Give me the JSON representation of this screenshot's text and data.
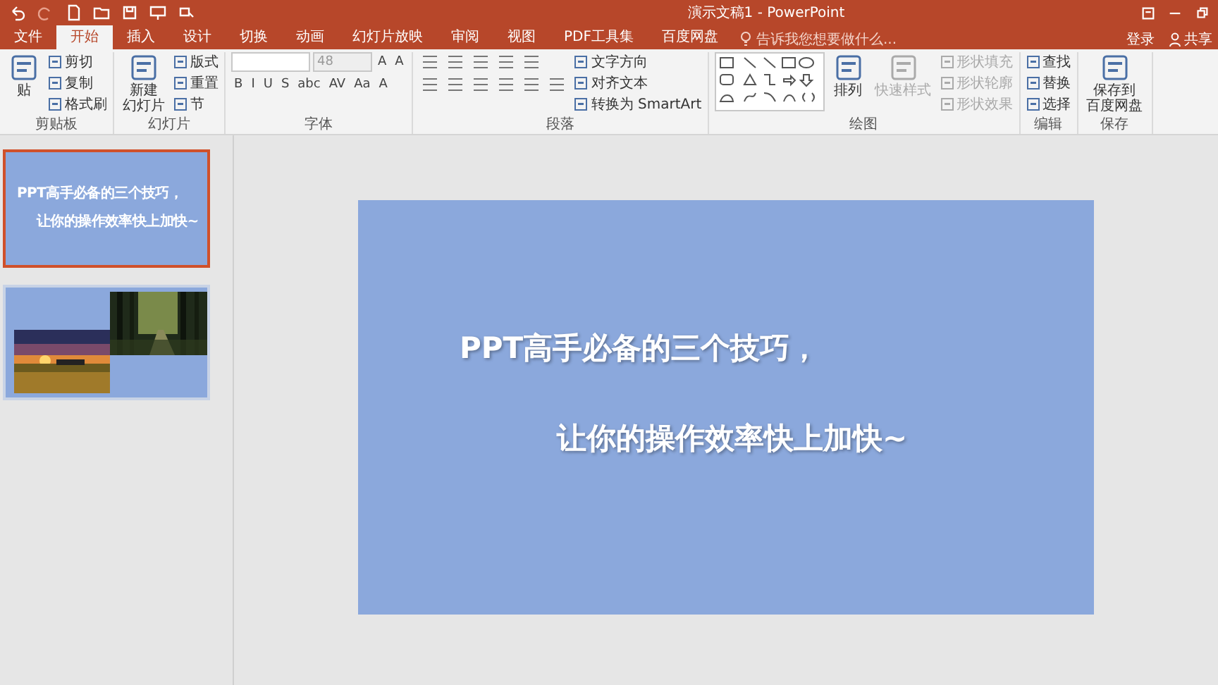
{
  "title_bar": {
    "title": "演示文稿1 - PowerPoint"
  },
  "tabs": [
    {
      "label": "文件",
      "selected": false
    },
    {
      "label": "开始",
      "selected": true
    },
    {
      "label": "插入",
      "selected": false
    },
    {
      "label": "设计",
      "selected": false
    },
    {
      "label": "切换",
      "selected": false
    },
    {
      "label": "动画",
      "selected": false
    },
    {
      "label": "幻灯片放映",
      "selected": false
    },
    {
      "label": "审阅",
      "selected": false
    },
    {
      "label": "视图",
      "selected": false
    },
    {
      "label": "PDF工具集",
      "selected": false
    },
    {
      "label": "百度网盘",
      "selected": false
    }
  ],
  "tell_me": {
    "placeholder": "告诉我您想要做什么..."
  },
  "account": {
    "sign_in": "登录",
    "share": "共享"
  },
  "ribbon": [
    {
      "label": "剪贴板",
      "columns": [
        [
          [
            {
              "kind": "large",
              "lines": [
                "贴"
              ],
              "disabled": false
            }
          ]
        ],
        [
          [
            {
              "kind": "small",
              "label": "剪切",
              "disabled": false
            }
          ],
          [
            {
              "kind": "small",
              "label": "复制",
              "disabled": false
            }
          ],
          [
            {
              "kind": "small",
              "label": "格式刷",
              "disabled": false
            }
          ]
        ]
      ]
    },
    {
      "label": "幻灯片",
      "columns": [
        [
          [
            {
              "kind": "large",
              "lines": [
                "新建",
                "幻灯片"
              ],
              "disabled": false
            }
          ]
        ],
        [
          [
            {
              "kind": "small",
              "label": "版式",
              "disabled": false
            }
          ],
          [
            {
              "kind": "small",
              "label": "重置",
              "disabled": false
            }
          ],
          [
            {
              "kind": "small",
              "label": "节",
              "disabled": false
            }
          ]
        ]
      ]
    },
    {
      "label": "字体",
      "columns": [
        [
          [
            {
              "kind": "field",
              "disabled": false
            },
            {
              "kind": "field",
              "label": "48",
              "disabled": true
            },
            {
              "kind": "glyph",
              "label": "A",
              "disabled": false
            },
            {
              "kind": "glyph",
              "label": "A",
              "disabled": false
            }
          ],
          [
            {
              "kind": "glyph",
              "label": "B",
              "disabled": false
            },
            {
              "kind": "glyph",
              "label": "I",
              "disabled": false
            },
            {
              "kind": "glyph",
              "label": "U",
              "disabled": false
            },
            {
              "kind": "glyph",
              "label": "S",
              "disabled": false
            },
            {
              "kind": "glyph",
              "label": "abc",
              "disabled": false
            },
            {
              "kind": "glyph",
              "label": "AV",
              "disabled": false
            },
            {
              "kind": "glyph",
              "label": "Aa",
              "disabled": false
            },
            {
              "kind": "glyph",
              "label": "A",
              "disabled": false
            }
          ]
        ]
      ]
    },
    {
      "label": "段落",
      "columns": [
        [
          [
            {
              "kind": "icon"
            },
            {
              "kind": "icon"
            },
            {
              "kind": "icon"
            },
            {
              "kind": "icon"
            },
            {
              "kind": "icon"
            }
          ],
          [
            {
              "kind": "icon"
            },
            {
              "kind": "icon"
            },
            {
              "kind": "icon"
            },
            {
              "kind": "icon"
            },
            {
              "kind": "icon"
            },
            {
              "kind": "icon"
            }
          ]
        ],
        [
          [
            {
              "kind": "small",
              "label": "文字方向",
              "disabled": false
            }
          ],
          [
            {
              "kind": "small",
              "label": "对齐文本",
              "disabled": false
            }
          ],
          [
            {
              "kind": "small",
              "label": "转换为 SmartArt",
              "disabled": false
            }
          ]
        ]
      ]
    },
    {
      "label": "绘图",
      "columns": [
        [
          [
            {
              "kind": "gallery"
            }
          ]
        ],
        [
          [
            {
              "kind": "large",
              "lines": [
                "排列"
              ],
              "disabled": false
            }
          ]
        ],
        [
          [
            {
              "kind": "large",
              "lines": [
                "快速样式"
              ],
              "disabled": true
            }
          ]
        ],
        [
          [
            {
              "kind": "small",
              "label": "形状填充",
              "disabled": true
            }
          ],
          [
            {
              "kind": "small",
              "label": "形状轮廓",
              "disabled": true
            }
          ],
          [
            {
              "kind": "small",
              "label": "形状效果",
              "disabled": true
            }
          ]
        ]
      ]
    },
    {
      "label": "编辑",
      "columns": [
        [
          [
            {
              "kind": "small",
              "label": "查找",
              "disabled": false
            }
          ],
          [
            {
              "kind": "small",
              "label": "替换",
              "disabled": false
            }
          ],
          [
            {
              "kind": "small",
              "label": "选择",
              "disabled": false
            }
          ]
        ]
      ]
    },
    {
      "label": "保存",
      "columns": [
        [
          [
            {
              "kind": "large",
              "lines": [
                "保存到",
                "百度网盘"
              ],
              "disabled": false
            }
          ]
        ]
      ]
    }
  ],
  "thumbnails": [
    {
      "kind": "text",
      "selected": true,
      "lines": [
        "PPT高手必备的三个技巧，",
        "让你的操作效率快上加快~"
      ]
    },
    {
      "kind": "pictures",
      "selected": false
    }
  ],
  "slide": {
    "lines": [
      "PPT高手必备的三个技巧，",
      "让你的操作效率快上加快~"
    ]
  }
}
